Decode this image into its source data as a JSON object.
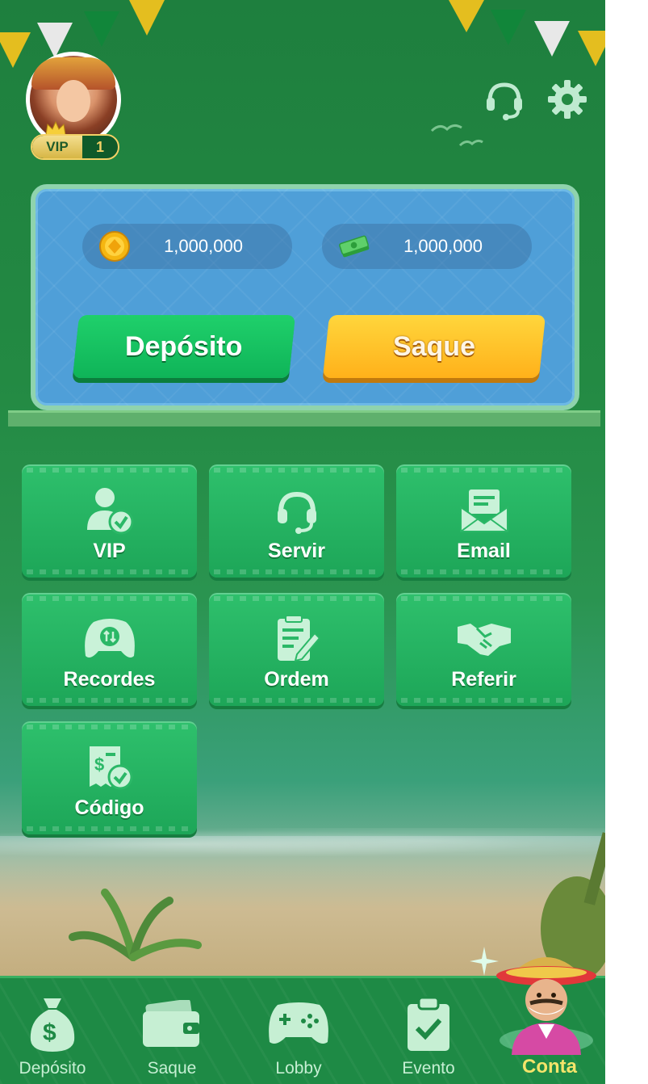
{
  "header": {
    "avatar_icon": "player-avatar",
    "vip_label": "VIP",
    "vip_level": "1",
    "support_icon": "headset-icon",
    "settings_icon": "gear-icon"
  },
  "wallet": {
    "coins": {
      "icon": "coin-icon",
      "value": "1,000,000"
    },
    "cash": {
      "icon": "cash-bundle-icon",
      "value": "1,000,000"
    },
    "deposit_label": "Depósito",
    "withdraw_label": "Saque"
  },
  "menu": [
    {
      "label": "VIP",
      "icon": "user-check-icon"
    },
    {
      "label": "Servir",
      "icon": "headset-icon"
    },
    {
      "label": "Email",
      "icon": "envelope-icon"
    },
    {
      "label": "Recordes",
      "icon": "gamepad-icon"
    },
    {
      "label": "Ordem",
      "icon": "clipboard-edit-icon"
    },
    {
      "label": "Referir",
      "icon": "handshake-icon"
    },
    {
      "label": "Código",
      "icon": "receipt-check-icon"
    }
  ],
  "nav": [
    {
      "label": "Depósito",
      "icon": "money-bag-icon",
      "active": false
    },
    {
      "label": "Saque",
      "icon": "wallet-icon",
      "active": false
    },
    {
      "label": "Lobby",
      "icon": "gamepad-icon",
      "active": false
    },
    {
      "label": "Evento",
      "icon": "clipboard-check-icon",
      "active": false
    },
    {
      "label": "Conta",
      "icon": "mascot-avatar",
      "active": true
    }
  ],
  "colors": {
    "background": "#1e7f3e",
    "tile": "#2ec06c",
    "deposit_button": "#1fd06b",
    "withdraw_button": "#ffc22a",
    "active_nav_label": "#f4e46a",
    "wallet_panel": "#4f9fd8"
  }
}
